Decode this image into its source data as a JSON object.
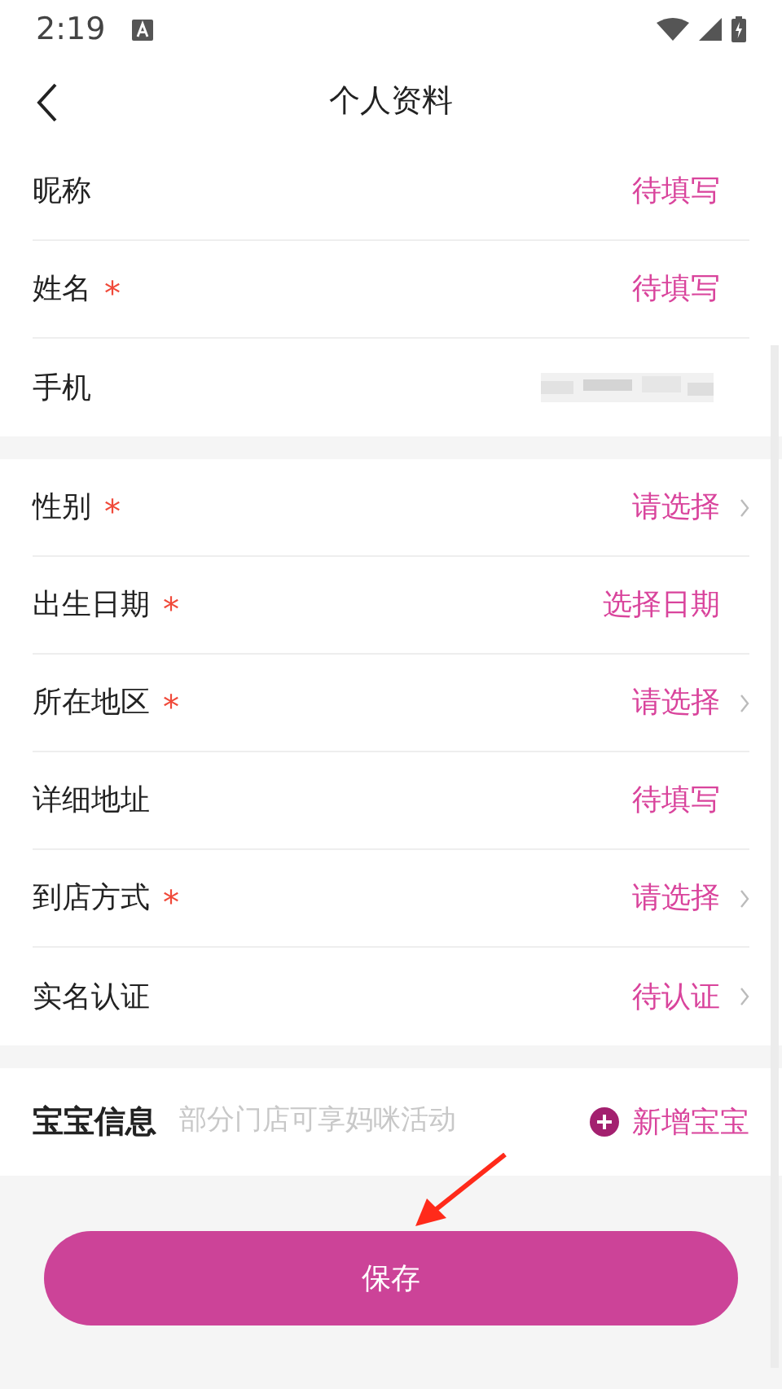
{
  "status_bar": {
    "time": "2:19"
  },
  "header": {
    "title": "个人资料"
  },
  "sections": [
    {
      "rows": [
        {
          "label": "昵称",
          "value": "待填写",
          "chevron": false,
          "redacted": false
        },
        {
          "label": "姓名",
          "required_mark": "*",
          "value": "待填写",
          "chevron": false,
          "redacted": false
        },
        {
          "label": "手机",
          "chevron": false,
          "redacted": true
        }
      ]
    },
    {
      "rows": [
        {
          "label": "性别",
          "required_mark": "*",
          "value": "请选择",
          "chevron": true,
          "redacted": false
        },
        {
          "label": "出生日期",
          "required_mark": "*",
          "value": "选择日期",
          "chevron": false,
          "redacted": false
        },
        {
          "label": "所在地区",
          "required_mark": "*",
          "value": "请选择",
          "chevron": true,
          "redacted": false
        },
        {
          "label": "详细地址",
          "value": "待填写",
          "chevron": false,
          "redacted": false
        },
        {
          "label": "到店方式",
          "required_mark": "*",
          "value": "请选择",
          "chevron": true,
          "redacted": false
        },
        {
          "label": "实名认证",
          "value": "待认证",
          "chevron": true,
          "redacted": false
        }
      ]
    }
  ],
  "baby": {
    "title": "宝宝信息",
    "hint": "部分门店可享妈咪活动",
    "add_button": "新增宝宝"
  },
  "save_button": "保存",
  "annotation": {
    "kind": "arrow"
  }
}
